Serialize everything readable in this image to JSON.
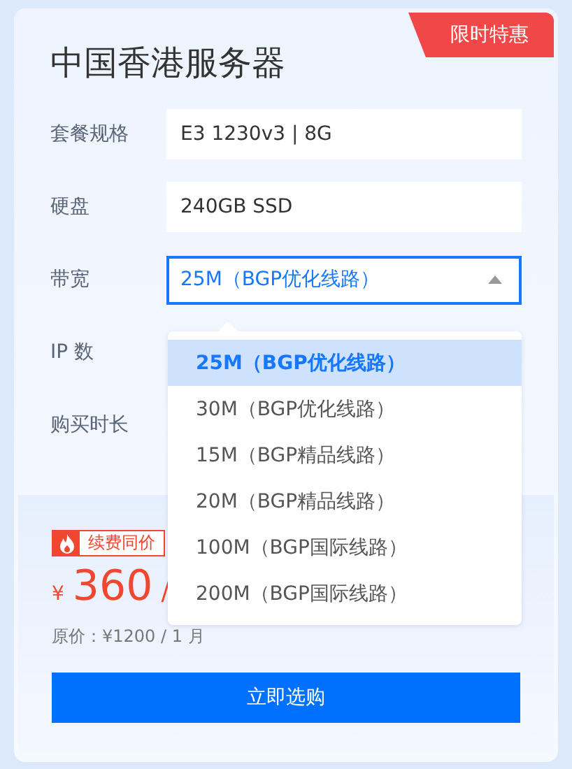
{
  "badge": "限时特惠",
  "title": "中国香港服务器",
  "fields": [
    {
      "label": "套餐规格",
      "kind": "text",
      "value": "E3 1230v3 | 8G"
    },
    {
      "label": "硬盘",
      "kind": "text",
      "value": "240GB SSD"
    },
    {
      "label": "带宽",
      "kind": "select",
      "value": "25M（BGP优化线路）",
      "expanded": true
    },
    {
      "label": "IP 数",
      "kind": "hidden"
    },
    {
      "label": "购买时长",
      "kind": "hidden"
    }
  ],
  "dropdown": [
    {
      "label": "25M（BGP优化线路）",
      "selected": true
    },
    {
      "label": "30M（BGP优化线路）",
      "selected": false
    },
    {
      "label": "15M（BGP精品线路）",
      "selected": false
    },
    {
      "label": "20M（BGP精品线路）",
      "selected": false
    },
    {
      "label": "100M（BGP国际线路）",
      "selected": false
    },
    {
      "label": "200M（BGP国际线路）",
      "selected": false
    }
  ],
  "price": {
    "tag": "续费同价",
    "currency": "¥",
    "amount": "360",
    "unit": "/",
    "original": "原价：¥1200 / 1 月"
  },
  "button": "立即选购"
}
